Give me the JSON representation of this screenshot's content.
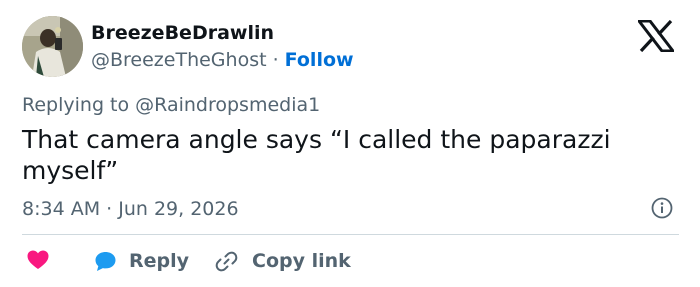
{
  "tweet": {
    "author": {
      "display_name": "BreezeBeDrawlin",
      "handle": "@BreezeTheGhost",
      "separator": " · ",
      "follow_label": "Follow"
    },
    "brand_icon": "x-logo-icon",
    "reply_context": {
      "prefix": "Replying to ",
      "mention": "@Raindropsmedia1"
    },
    "text": "That camera angle says “I called the paparazzi myself”",
    "timestamp": "8:34 AM · Jun 29, 2026",
    "info_icon": "info-icon",
    "actions": {
      "like_icon": "heart-icon",
      "reply_icon": "speech-bubble-icon",
      "reply_label": "Reply",
      "copy_icon": "link-icon",
      "copy_label": "Copy link"
    }
  },
  "colors": {
    "text_primary": "#0f1419",
    "text_secondary": "#536471",
    "follow_blue": "#006fd6",
    "heart_pink": "#f91880",
    "reply_blue": "#1d9bf0",
    "divider": "#cfd9de"
  }
}
